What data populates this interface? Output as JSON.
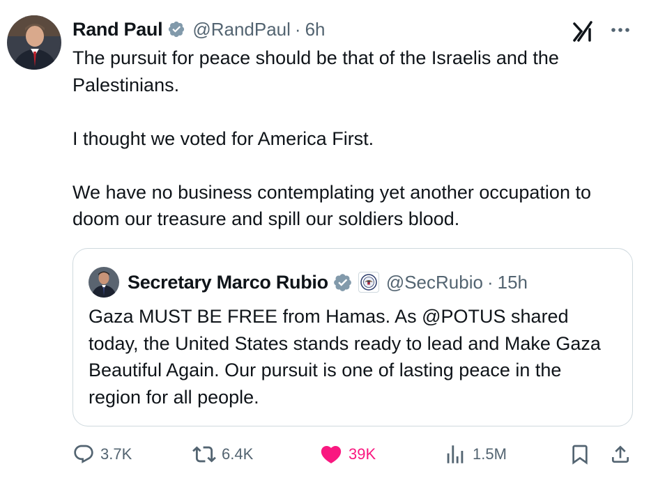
{
  "tweet": {
    "author_name": "Rand Paul",
    "author_handle": "@RandPaul",
    "separator": "·",
    "time": "6h",
    "paragraphs": [
      "The pursuit for peace should be that of the Israelis and the Palestinians.",
      "I thought we voted for America First.",
      "We have no business contemplating yet another occupation to doom our treasure and spill our soldiers blood."
    ]
  },
  "quoted": {
    "author_name": "Secretary Marco Rubio",
    "author_handle": "@SecRubio",
    "separator": "·",
    "time": "15h",
    "text": "Gaza MUST BE FREE from Hamas. As @POTUS shared today, the United States stands ready to lead and Make Gaza Beautiful Again. Our pursuit is one of lasting peace in the region for all people."
  },
  "actions": {
    "replies": "3.7K",
    "reposts": "6.4K",
    "likes": "39K",
    "views": "1.5M"
  },
  "icons": {
    "verified": "verified-badge-icon",
    "grok": "grok-icon",
    "more": "more-icon",
    "reply": "reply-icon",
    "repost": "repost-icon",
    "like": "heart-icon",
    "views": "views-icon",
    "bookmark": "bookmark-icon",
    "share": "share-icon",
    "seal": "state-department-seal-icon"
  },
  "colors": {
    "text": "#0f1419",
    "secondary": "#536471",
    "verified": "#829aab",
    "like": "#f91880",
    "border": "#cfd9de"
  }
}
